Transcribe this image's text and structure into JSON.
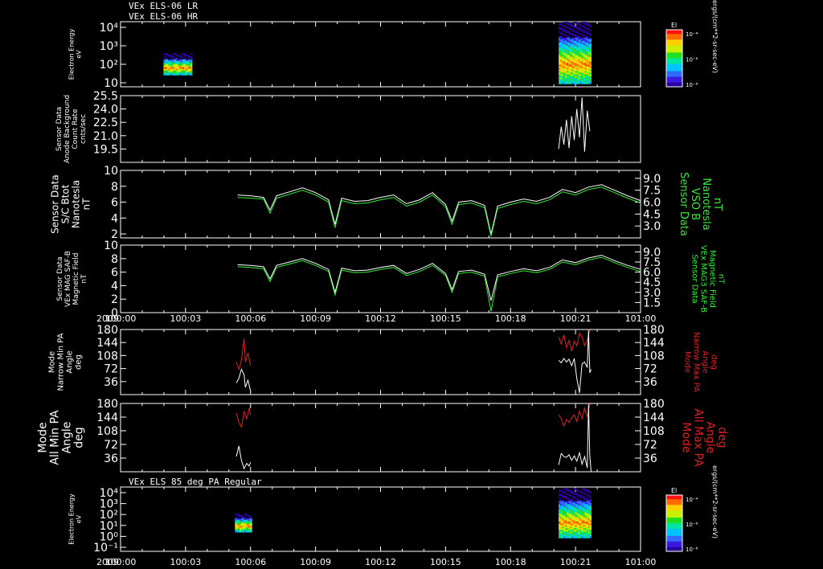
{
  "header": {
    "line1": "VEx ELS-06 LR",
    "line2": "VEx ELS-06 HR",
    "footer_title": "VEx ELS 85 deg PA Regular"
  },
  "colors": {
    "background": "#000000",
    "white": "#ffffff",
    "green": "#33ee33",
    "red": "#dd2222"
  },
  "chart_data": [
    {
      "type": "heatmap",
      "name": "electron-energy-top",
      "ylabel": [
        "Electron Energy",
        "eV"
      ],
      "yscale": "log",
      "ylim": [
        2,
        15000
      ],
      "y_ticks": [
        "10⁴",
        "10³",
        "10²",
        "10"
      ],
      "colorbar": {
        "title": "El",
        "ticks": [
          "10⁻⁴",
          "10⁻⁶",
          "10⁻⁸"
        ],
        "units": "ergs/(cm**2-sr-sec-eV)"
      },
      "blocks": [
        {
          "t_start": 100.033,
          "t_end": 100.055,
          "e_low": 10,
          "e_high": 200
        },
        {
          "t_start": 100.337,
          "t_end": 100.362,
          "e_low": 3,
          "e_high": 15000
        }
      ]
    },
    {
      "type": "line",
      "name": "anode-background",
      "ylabel": [
        "Sensor Data",
        "Anode Background",
        "Count Rate",
        "cnts/sec"
      ],
      "ylim": [
        18,
        25.5
      ],
      "y_ticks": [
        "25.5",
        "24.0",
        "22.5",
        "21.0",
        "19.5"
      ],
      "y_tick_values": [
        25.5,
        24.0,
        22.5,
        21.0,
        19.5
      ],
      "series": [
        {
          "color": "white",
          "x": [
            100.337,
            100.339,
            100.341,
            100.343,
            100.345,
            100.347,
            100.349,
            100.351,
            100.353,
            100.355,
            100.357,
            100.359,
            100.361
          ],
          "values": [
            19.5,
            22.0,
            20.0,
            22.8,
            19.6,
            23.2,
            20.5,
            24.0,
            20.8,
            25.3,
            19.2,
            23.8,
            21.5
          ]
        }
      ]
    },
    {
      "type": "line",
      "name": "sc-btot",
      "ylabel": [
        "Sensor Data",
        "S/C Btot",
        "Nanotesla",
        "nT"
      ],
      "ylabel_right": [
        "Sensor Data",
        "VSO B",
        "Nanotesla",
        "nT"
      ],
      "ylim": [
        1.5,
        10
      ],
      "y_ticks": [
        "10",
        "8",
        "6",
        "4",
        "2"
      ],
      "y_tick_values": [
        10,
        8,
        6,
        4,
        2
      ],
      "y_ticks_right": [
        "9.0",
        "7.5",
        "6.0",
        "4.5",
        "3.0"
      ],
      "y_tick_values_right": [
        9.0,
        7.5,
        6.0,
        4.5,
        3.0
      ],
      "x": [
        100.09,
        100.1,
        100.11,
        100.115,
        100.12,
        100.13,
        100.14,
        100.15,
        100.16,
        100.165,
        100.17,
        100.18,
        100.19,
        100.2,
        100.21,
        100.22,
        100.23,
        100.24,
        100.25,
        100.255,
        100.26,
        100.27,
        100.28,
        100.285,
        100.29,
        100.3,
        100.31,
        100.32,
        100.33,
        100.34,
        100.35,
        100.36,
        100.37,
        100.38,
        100.39,
        100.4
      ],
      "series": [
        {
          "color": "white",
          "values": [
            6.9,
            6.8,
            6.6,
            5.0,
            6.8,
            7.3,
            7.8,
            7.2,
            6.3,
            3.2,
            6.5,
            6.1,
            6.2,
            6.6,
            6.9,
            5.8,
            6.3,
            7.2,
            5.7,
            3.6,
            6.0,
            6.2,
            5.6,
            2.0,
            5.5,
            6.0,
            6.4,
            6.1,
            6.6,
            7.6,
            7.2,
            7.9,
            8.2,
            7.5,
            6.8,
            6.2
          ]
        },
        {
          "color": "green",
          "values": [
            6.6,
            6.5,
            6.4,
            4.6,
            6.5,
            7.0,
            7.5,
            6.9,
            6.0,
            2.8,
            6.2,
            5.8,
            5.9,
            6.3,
            6.6,
            5.5,
            6.0,
            6.9,
            5.4,
            3.2,
            5.7,
            5.9,
            5.3,
            1.7,
            5.2,
            5.7,
            6.1,
            5.8,
            6.3,
            7.3,
            6.9,
            7.6,
            7.9,
            7.2,
            6.5,
            5.9
          ]
        }
      ]
    },
    {
      "type": "line",
      "name": "mag-field",
      "ylabel": [
        "Sensor Data",
        "VEx MAG SAF-B",
        "Magnetic Field",
        "nT"
      ],
      "ylabel_right": [
        "Sensor Data",
        "VEx MAG3 SAF-B",
        "Magnetic Field",
        "nT"
      ],
      "ylim": [
        0,
        10
      ],
      "y_ticks": [
        "10",
        "8",
        "6",
        "4",
        "2",
        "0"
      ],
      "y_tick_values": [
        10,
        8,
        6,
        4,
        2,
        0
      ],
      "y_ticks_right": [
        "9.0",
        "7.5",
        "6.0",
        "4.5",
        "3.0",
        "1.5"
      ],
      "y_tick_values_right": [
        9.0,
        7.5,
        6.0,
        4.5,
        3.0,
        1.5
      ],
      "x": [
        100.09,
        100.1,
        100.11,
        100.115,
        100.12,
        100.13,
        100.14,
        100.15,
        100.16,
        100.165,
        100.17,
        100.18,
        100.19,
        100.2,
        100.21,
        100.22,
        100.23,
        100.24,
        100.25,
        100.255,
        100.26,
        100.27,
        100.28,
        100.285,
        100.29,
        100.3,
        100.31,
        100.32,
        100.33,
        100.34,
        100.35,
        100.36,
        100.37,
        100.38,
        100.39,
        100.4
      ],
      "series": [
        {
          "color": "white",
          "values": [
            7.1,
            7.0,
            6.8,
            5.0,
            7.0,
            7.5,
            8.0,
            7.3,
            6.4,
            3.0,
            6.6,
            6.2,
            6.3,
            6.7,
            7.0,
            5.8,
            6.4,
            7.3,
            5.8,
            3.4,
            6.1,
            6.3,
            5.7,
            1.8,
            5.6,
            6.1,
            6.5,
            6.2,
            6.7,
            7.8,
            7.4,
            8.1,
            8.5,
            7.7,
            7.0,
            6.4
          ]
        },
        {
          "color": "green",
          "values": [
            6.8,
            6.7,
            6.5,
            4.6,
            6.7,
            7.2,
            7.7,
            7.0,
            6.1,
            2.6,
            6.3,
            5.9,
            6.0,
            6.4,
            6.7,
            5.5,
            6.1,
            7.0,
            5.5,
            3.0,
            5.8,
            6.0,
            5.4,
            0.2,
            5.3,
            5.8,
            6.2,
            5.9,
            6.4,
            7.5,
            7.1,
            7.8,
            8.2,
            7.4,
            6.7,
            6.1
          ]
        }
      ]
    },
    {
      "type": "line",
      "name": "narrow-pa",
      "ylabel": [
        "Mode",
        "Narrow Min PA",
        "Angle",
        "deg"
      ],
      "ylabel_right": [
        "Mode",
        "Narrow Max PA",
        "Angle",
        "deg"
      ],
      "ylim": [
        0,
        180
      ],
      "y_ticks": [
        "180",
        "144",
        "108",
        "72",
        "36"
      ],
      "y_tick_values": [
        180,
        144,
        108,
        72,
        36
      ],
      "series": [
        {
          "color": "red",
          "x": [
            100.089,
            100.091,
            100.093,
            100.095,
            100.096,
            100.098,
            100.1
          ],
          "values": [
            90,
            70,
            95,
            155,
            90,
            115,
            80
          ]
        },
        {
          "color": "white",
          "x": [
            100.089,
            100.091,
            100.093,
            100.095,
            100.096,
            100.098,
            100.1
          ],
          "values": [
            32,
            45,
            70,
            55,
            20,
            40,
            10
          ]
        },
        {
          "color": "red",
          "x": [
            100.337,
            100.339,
            100.341,
            100.343,
            100.345,
            100.347,
            100.349,
            100.351,
            100.353,
            100.355,
            100.357,
            100.359,
            100.361,
            100.362
          ],
          "values": [
            160,
            140,
            165,
            130,
            150,
            120,
            148,
            135,
            170,
            160,
            135,
            150,
            178,
            178
          ]
        },
        {
          "color": "white",
          "x": [
            100.337,
            100.339,
            100.341,
            100.343,
            100.345,
            100.347,
            100.349,
            100.351,
            100.353,
            100.355,
            100.357,
            100.359,
            100.36,
            100.361,
            100.362
          ],
          "values": [
            95,
            88,
            100,
            90,
            98,
            80,
            100,
            45,
            5,
            85,
            90,
            75,
            178,
            60,
            70
          ]
        }
      ]
    },
    {
      "type": "line",
      "name": "all-pa",
      "ylabel": [
        "Mode",
        "All Min PA",
        "Angle",
        "deg"
      ],
      "ylabel_right": [
        "Mode",
        "All Max PA",
        "Angle",
        "deg"
      ],
      "ylim": [
        0,
        180
      ],
      "y_ticks": [
        "180",
        "144",
        "108",
        "72",
        "36"
      ],
      "y_tick_values": [
        180,
        144,
        108,
        72,
        36
      ],
      "series": [
        {
          "color": "red",
          "x": [
            100.089,
            100.091,
            100.093,
            100.095,
            100.097,
            100.099,
            100.1
          ],
          "values": [
            155,
            130,
            118,
            160,
            140,
            168,
            150
          ]
        },
        {
          "color": "white",
          "x": [
            100.089,
            100.091,
            100.093,
            100.095,
            100.097,
            100.099,
            100.1
          ],
          "values": [
            40,
            68,
            30,
            8,
            22,
            15,
            25
          ]
        },
        {
          "color": "red",
          "x": [
            100.337,
            100.339,
            100.341,
            100.343,
            100.345,
            100.347,
            100.349,
            100.351,
            100.353,
            100.355,
            100.357,
            100.359,
            100.361,
            100.362
          ],
          "values": [
            150,
            140,
            120,
            138,
            130,
            142,
            150,
            132,
            160,
            140,
            168,
            145,
            178,
            178
          ]
        },
        {
          "color": "white",
          "x": [
            100.337,
            100.339,
            100.341,
            100.343,
            100.345,
            100.347,
            100.349,
            100.351,
            100.353,
            100.355,
            100.357,
            100.359,
            100.36,
            100.361,
            100.362
          ],
          "values": [
            18,
            48,
            40,
            38,
            45,
            30,
            42,
            28,
            50,
            20,
            40,
            10,
            178,
            40,
            0
          ]
        }
      ]
    },
    {
      "type": "heatmap",
      "name": "electron-energy-bottom",
      "ylabel": [
        "Electron Energy",
        "eV"
      ],
      "yscale": "log",
      "ylim": [
        0.08,
        15000
      ],
      "y_ticks": [
        "10⁴",
        "10³",
        "10²",
        "10¹",
        "10⁰",
        "10⁻¹"
      ],
      "colorbar": {
        "title": "El",
        "ticks": [
          "10⁻⁴",
          "10⁻⁶",
          "10⁻⁸"
        ],
        "units": "ergs/(cm**2-sr-sec-eV)"
      },
      "blocks": [
        {
          "t_start": 100.088,
          "t_end": 100.101,
          "e_low": 3,
          "e_high": 100
        },
        {
          "t_start": 100.337,
          "t_end": 100.362,
          "e_low": 1,
          "e_high": 12000
        }
      ]
    }
  ],
  "x_axis": {
    "year_label": "2009",
    "ticks": [
      "100:00",
      "100:03",
      "100:06",
      "100:09",
      "100:12",
      "100:15",
      "100:18",
      "100:21",
      "101:00"
    ],
    "tick_values": [
      100.0,
      100.05,
      100.1,
      100.15,
      100.2,
      100.25,
      100.3,
      100.35,
      100.4
    ],
    "xlim": [
      100.0,
      100.4
    ]
  }
}
